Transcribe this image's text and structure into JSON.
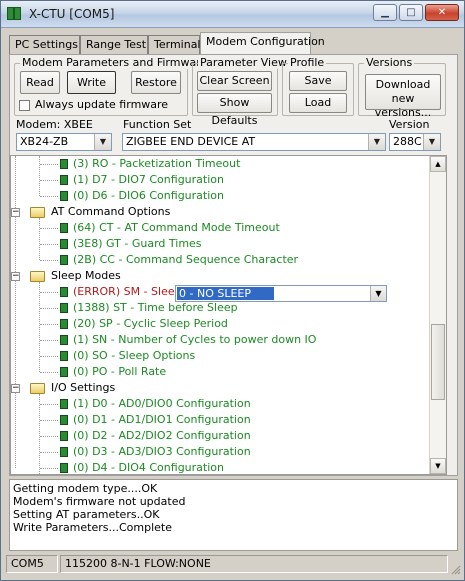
{
  "window": {
    "title": "X-CTU  [COM5]",
    "controls": [
      "minimize-icon",
      "maximize-icon",
      "close-icon"
    ]
  },
  "tabs": [
    {
      "label": "PC Settings",
      "active": false
    },
    {
      "label": "Range Test",
      "active": false
    },
    {
      "label": "Terminal",
      "active": false
    },
    {
      "label": "Modem Configuration",
      "active": true
    }
  ],
  "modem_params": {
    "legend": "Modem Parameters and Firmware",
    "read": "Read",
    "write": "Write",
    "restore": "Restore",
    "always_update": "Always update firmware",
    "always_update_checked": false
  },
  "param_view": {
    "legend": "Parameter View",
    "clear": "Clear Screen",
    "defaults": "Show Defaults"
  },
  "profile": {
    "legend": "Profile",
    "save": "Save",
    "load": "Load"
  },
  "versions": {
    "legend": "Versions",
    "download": "Download new versions..."
  },
  "selectors": {
    "modem_label": "Modem: XBEE",
    "modem_value": "XB24-ZB",
    "function_label": "Function Set",
    "function_value": "ZIGBEE END DEVICE AT",
    "version_label": "Version",
    "version_value": "288C"
  },
  "tree": {
    "rows": [
      {
        "kind": "leaf",
        "text": "(3) RO - Packetization Timeout",
        "color": "green"
      },
      {
        "kind": "leaf",
        "text": "(1) D7 - DIO7 Configuration",
        "color": "green"
      },
      {
        "kind": "leaf",
        "text": "(0) D6 - DIO6 Configuration",
        "color": "green"
      },
      {
        "kind": "folder",
        "text": "AT Command Options"
      },
      {
        "kind": "leaf",
        "text": "(64) CT - AT Command Mode Timeout",
        "color": "green"
      },
      {
        "kind": "leaf",
        "text": "(3E8) GT - Guard Times",
        "color": "green"
      },
      {
        "kind": "leaf",
        "text": "(2B) CC - Command Sequence Character",
        "color": "green"
      },
      {
        "kind": "folder",
        "text": "Sleep Modes"
      },
      {
        "kind": "leaf",
        "text": "(ERROR) SM - Sleep",
        "color": "red",
        "editor_value": "0 - NO SLEEP"
      },
      {
        "kind": "leaf",
        "text": "(1388) ST - Time before Sleep",
        "color": "green"
      },
      {
        "kind": "leaf",
        "text": "(20) SP - Cyclic Sleep Period",
        "color": "green"
      },
      {
        "kind": "leaf",
        "text": "(1) SN - Number of Cycles to power down IO",
        "color": "green"
      },
      {
        "kind": "leaf",
        "text": "(0) SO - Sleep Options",
        "color": "green"
      },
      {
        "kind": "leaf",
        "text": "(0) PO - Poll Rate",
        "color": "green"
      },
      {
        "kind": "folder",
        "text": "I/O Settings"
      },
      {
        "kind": "leaf",
        "text": "(1) D0 - AD0/DIO0 Configuration",
        "color": "green"
      },
      {
        "kind": "leaf",
        "text": "(0) D1 - AD1/DIO1 Configuration",
        "color": "green"
      },
      {
        "kind": "leaf",
        "text": "(0) D2 - AD2/DIO2 Configuration",
        "color": "green"
      },
      {
        "kind": "leaf",
        "text": "(0) D3 - AD3/DIO3 Configuration",
        "color": "green"
      },
      {
        "kind": "leaf",
        "text": "(0) D4 - DIO4 Configuration",
        "color": "green"
      }
    ]
  },
  "log": [
    "Getting modem type....OK",
    "Modem's firmware not updated",
    "Setting AT parameters..OK",
    "Write Parameters...Complete"
  ],
  "status": {
    "port": "COM5",
    "settings": "115200 8-N-1  FLOW:NONE"
  },
  "colors": {
    "green": "#1b8a22",
    "red": "#b11b1b",
    "selection": "#316ac5"
  }
}
